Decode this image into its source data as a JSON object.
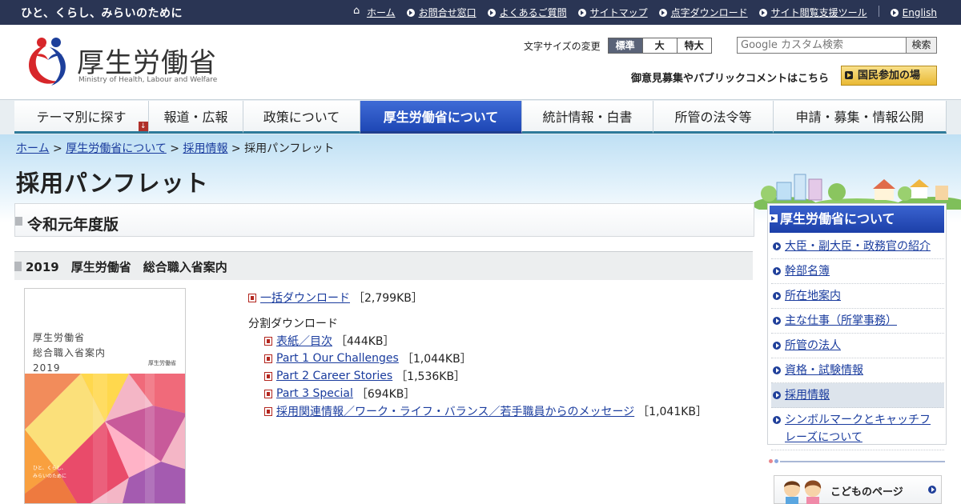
{
  "topbar": {
    "slogan": "ひと、くらし、みらいのために",
    "links": [
      {
        "label": "ホーム",
        "icon": "home-icon"
      },
      {
        "label": "お問合せ窓口",
        "icon": "arrow-circle-icon"
      },
      {
        "label": "よくあるご質問",
        "icon": "arrow-circle-icon"
      },
      {
        "label": "サイトマップ",
        "icon": "arrow-circle-icon"
      },
      {
        "label": "点字ダウンロード",
        "icon": "arrow-circle-icon"
      },
      {
        "label": "サイト閲覧支援ツール",
        "icon": "arrow-circle-icon"
      }
    ],
    "english": "English"
  },
  "header": {
    "logo_text": "厚生労働省",
    "logo_sub": "Ministry of Health, Labour and Welfare",
    "fontsize_label": "文字サイズの変更",
    "fontsize_options": [
      "標準",
      "大",
      "特大"
    ],
    "fontsize_selected": "標準",
    "search_placeholder": "Google カスタム検索",
    "search_button": "検索",
    "pubcom": "御意見募集やパブリックコメントはこちら",
    "kokumin_button": "国民参加の場"
  },
  "mainnav": {
    "tabs": [
      {
        "label": "テーマ別に探す"
      },
      {
        "label": "報道・広報"
      },
      {
        "label": "政策について"
      },
      {
        "label": "厚生労働省について"
      },
      {
        "label": "統計情報・白書"
      },
      {
        "label": "所管の法令等"
      },
      {
        "label": "申請・募集・情報公開"
      }
    ],
    "active": "厚生労働省について"
  },
  "breadcrumb": {
    "items": [
      "ホーム",
      "厚生労働省について",
      "採用情報"
    ],
    "separator": ">",
    "current": "採用パンフレット"
  },
  "page_title": "採用パンフレット",
  "content": {
    "section_title": "令和元年度版",
    "subsection_title": "2019　厚生労働省　総合職入省案内",
    "cover": {
      "title_lines": [
        "厚生労働省",
        "総合職入省案内",
        "2019"
      ],
      "logo_label": "厚生労働省",
      "slogan_lines": [
        "ひと、くらし、",
        "みらいのために"
      ]
    },
    "bulk_download": {
      "label": "一括ダウンロード",
      "size": "［2,799KB］"
    },
    "split_label": "分割ダウンロード",
    "split_downloads": [
      {
        "label": "表紙／目次",
        "size": "［444KB］"
      },
      {
        "label": "Part 1 Our Challenges",
        "size": "［1,044KB］"
      },
      {
        "label": "Part 2 Career Stories",
        "size": "［1,536KB］"
      },
      {
        "label": "Part 3 Special",
        "size": "［694KB］"
      },
      {
        "label": "採用関連情報／ワーク・ライフ・バランス／若手職員からのメッセージ",
        "size": "［1,041KB］"
      }
    ]
  },
  "sidebar": {
    "title": "厚生労働省について",
    "links": [
      {
        "label": "大臣・副大臣・政務官の紹介"
      },
      {
        "label": "幹部名簿"
      },
      {
        "label": "所在地案内"
      },
      {
        "label": "主な仕事（所掌事務）"
      },
      {
        "label": "所管の法人"
      },
      {
        "label": "資格・試験情報"
      },
      {
        "label": "採用情報"
      },
      {
        "label": "シンボルマークとキャッチフレーズについて"
      }
    ],
    "active": "採用情報",
    "kodomo": "こどものページ"
  },
  "colors": {
    "topbar_bg": "#2a3554",
    "nav_active": "#1e47b5",
    "link": "#1a3c9e",
    "kokumin_button": "#e9b934"
  }
}
